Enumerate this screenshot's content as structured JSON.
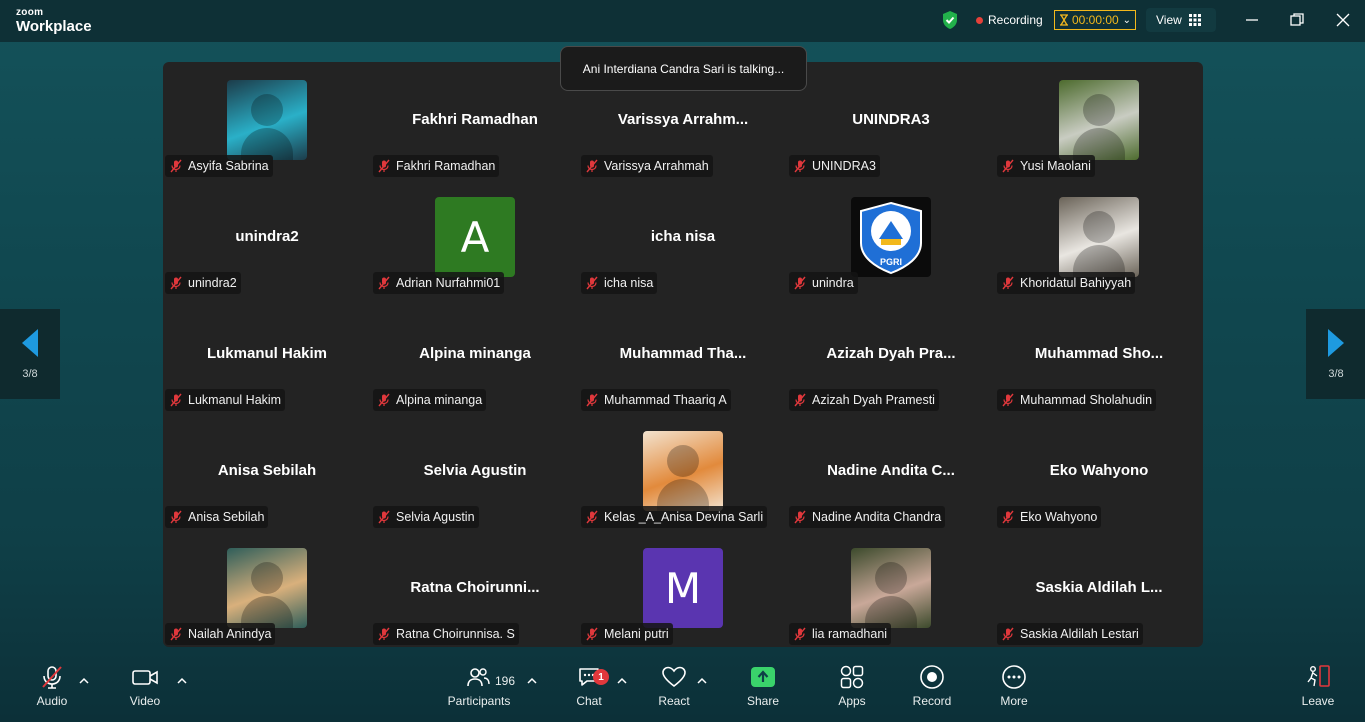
{
  "app": {
    "brand_top": "zoom",
    "brand_bottom": "Workplace"
  },
  "header": {
    "recording_label": "Recording",
    "timer": "00:00:00",
    "view_label": "View"
  },
  "toast": {
    "text": "Ani Interdiana Candra Sari is talking..."
  },
  "pager": {
    "prev_count": "3/8",
    "next_count": "3/8"
  },
  "participants": [
    {
      "display": "",
      "label": "Asyifa Sabrina",
      "avatar": "photo",
      "photo_colors": [
        "#1c3c4a",
        "#2ab0c8"
      ]
    },
    {
      "display": "Fakhri Ramadhan",
      "label": "Fakhri Ramadhan",
      "avatar": "none"
    },
    {
      "display": "Varissya Arrahm...",
      "label": "Varissya Arrahmah",
      "avatar": "none"
    },
    {
      "display": "UNINDRA3",
      "label": "UNINDRA3",
      "avatar": "none"
    },
    {
      "display": "",
      "label": "Yusi Maolani",
      "avatar": "photo",
      "photo_colors": [
        "#4d6b2e",
        "#c9ccc2"
      ]
    },
    {
      "display": "unindra2",
      "label": "unindra2",
      "avatar": "none"
    },
    {
      "display": "",
      "label": "Adrian Nurfahmi01",
      "avatar": "letter",
      "letter": "A",
      "color": "#2e7a22"
    },
    {
      "display": "icha nisa",
      "label": "icha nisa",
      "avatar": "none"
    },
    {
      "display": "",
      "label": "unindra",
      "avatar": "logo",
      "logo_text": "PGRI"
    },
    {
      "display": "",
      "label": "Khoridatul Bahiyyah",
      "avatar": "photo",
      "photo_colors": [
        "#6a6358",
        "#e9e6e1"
      ]
    },
    {
      "display": "Lukmanul Hakim",
      "label": "Lukmanul Hakim",
      "avatar": "none"
    },
    {
      "display": "Alpina minanga",
      "label": "Alpina minanga",
      "avatar": "none"
    },
    {
      "display": "Muhammad  Tha...",
      "label": "Muhammad Thaariq A",
      "avatar": "none"
    },
    {
      "display": "Azizah  Dyah  Pra...",
      "label": "Azizah Dyah Pramesti",
      "avatar": "none"
    },
    {
      "display": "Muhammad  Sho...",
      "label": "Muhammad Sholahudin",
      "avatar": "none"
    },
    {
      "display": "Anisa Sebilah",
      "label": "Anisa Sebilah",
      "avatar": "none"
    },
    {
      "display": "Selvia Agustin",
      "label": "Selvia Agustin",
      "avatar": "none"
    },
    {
      "display": "",
      "label": "Kelas _A_Anisa Devina Sarli",
      "avatar": "photo",
      "photo_colors": [
        "#f3e3cf",
        "#e28a3c"
      ]
    },
    {
      "display": "Nadine  Andita  C...",
      "label": "Nadine Andita Chandra",
      "avatar": "none"
    },
    {
      "display": "Eko Wahyono",
      "label": "Eko Wahyono",
      "avatar": "none"
    },
    {
      "display": "",
      "label": "Nailah Anindya",
      "avatar": "photo",
      "photo_colors": [
        "#2f5e5a",
        "#d9b07c"
      ]
    },
    {
      "display": "Ratna  Choirunni...",
      "label": "Ratna Choirunnisa. S",
      "avatar": "none"
    },
    {
      "display": "",
      "label": "Melani putri",
      "avatar": "letter",
      "letter": "M",
      "color": "#5a35b0"
    },
    {
      "display": "",
      "label": "lia ramadhani",
      "avatar": "photo",
      "photo_colors": [
        "#3c4a2c",
        "#c9a899"
      ]
    },
    {
      "display": "Saskia  Aldilah  L...",
      "label": "Saskia Aldilah Lestari",
      "avatar": "none"
    }
  ],
  "toolbar": {
    "audio": "Audio",
    "video": "Video",
    "participants": "Participants",
    "participants_count": "196",
    "chat": "Chat",
    "chat_badge": "1",
    "react": "React",
    "share": "Share",
    "apps": "Apps",
    "record": "Record",
    "more": "More",
    "leave": "Leave"
  },
  "colors": {
    "share_accent": "#3ad36b",
    "leave_accent": "#e0383c",
    "timer_accent": "#f2b81c"
  }
}
